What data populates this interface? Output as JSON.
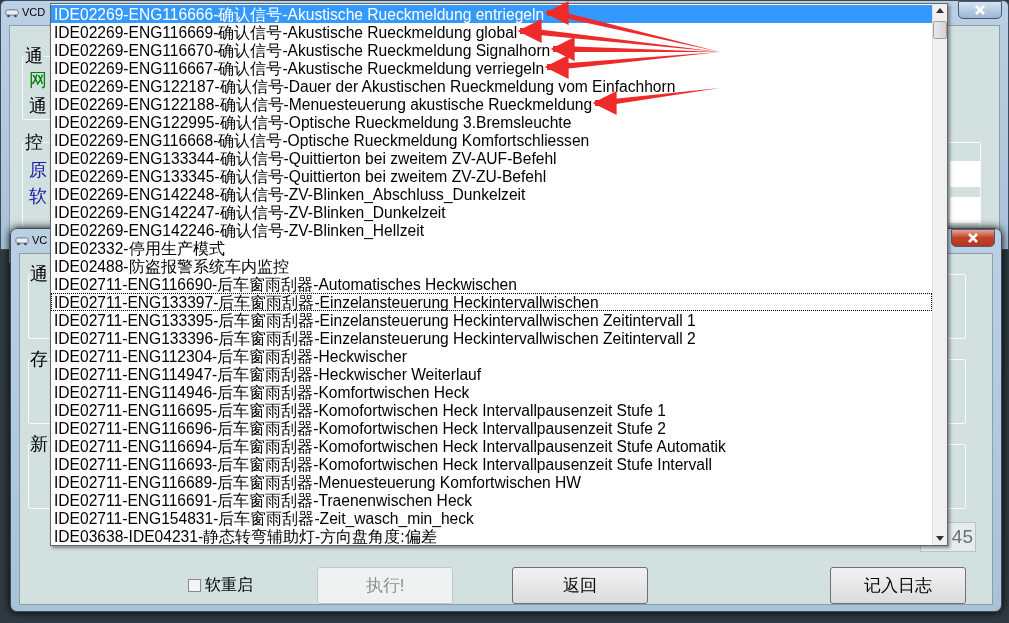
{
  "back_window": {
    "title": "VCD",
    "group_1": {
      "label": "通",
      "lines": [
        {
          "text": "网",
          "color": "#008000"
        },
        {
          "text": "通",
          "color": "#000000"
        }
      ]
    },
    "group_2": {
      "label": "控",
      "lines": [
        {
          "text": "原",
          "color": "#1a1aa0"
        },
        {
          "text": "软",
          "color": "#1a1aa0"
        }
      ]
    }
  },
  "front_window": {
    "title": "VC",
    "groups": [
      {
        "label": "通"
      },
      {
        "label": "存"
      },
      {
        "label": "新"
      }
    ],
    "field_value": "45",
    "soft_restart": {
      "label": "软重启",
      "checked": false
    },
    "buttons": [
      {
        "label": "执行!",
        "disabled": true
      },
      {
        "label": "返回",
        "disabled": false
      },
      {
        "label": "记入日志",
        "disabled": false
      }
    ]
  },
  "dropdown": {
    "items": [
      {
        "text": "IDE02269-ENG116666-确认信号-Akustische Rueckmeldung entriegeln",
        "selected": true,
        "focused": false,
        "marked": true
      },
      {
        "text": "IDE02269-ENG116669-确认信号-Akustische Rueckmeldung global",
        "selected": false,
        "focused": false,
        "marked": true
      },
      {
        "text": "IDE02269-ENG116670-确认信号-Akustische Rueckmeldung Signalhorn",
        "selected": false,
        "focused": false,
        "marked": true
      },
      {
        "text": "IDE02269-ENG116667-确认信号-Akustische Rueckmeldung verriegeln",
        "selected": false,
        "focused": false,
        "marked": true
      },
      {
        "text": "IDE02269-ENG122187-确认信号-Dauer der Akustischen Rueckmeldung vom Einfachhorn",
        "selected": false,
        "focused": false,
        "marked": false
      },
      {
        "text": "IDE02269-ENG122188-确认信号-Menuesteuerung akustische Rueckmeldung",
        "selected": false,
        "focused": false,
        "marked": true
      },
      {
        "text": "IDE02269-ENG122995-确认信号-Optische Rueckmeldung 3.Bremsleuchte",
        "selected": false,
        "focused": false,
        "marked": false
      },
      {
        "text": "IDE02269-ENG116668-确认信号-Optische Rueckmeldung Komfortschliessen",
        "selected": false,
        "focused": false,
        "marked": false
      },
      {
        "text": "IDE02269-ENG133344-确认信号-Quittierton bei zweitem ZV-AUF-Befehl",
        "selected": false,
        "focused": false,
        "marked": false
      },
      {
        "text": "IDE02269-ENG133345-确认信号-Quittierton bei zweitem ZV-ZU-Befehl",
        "selected": false,
        "focused": false,
        "marked": false
      },
      {
        "text": "IDE02269-ENG142248-确认信号-ZV-Blinken_Abschluss_Dunkelzeit",
        "selected": false,
        "focused": false,
        "marked": false
      },
      {
        "text": "IDE02269-ENG142247-确认信号-ZV-Blinken_Dunkelzeit",
        "selected": false,
        "focused": false,
        "marked": false
      },
      {
        "text": "IDE02269-ENG142246-确认信号-ZV-Blinken_Hellzeit",
        "selected": false,
        "focused": false,
        "marked": false
      },
      {
        "text": "IDE02332-停用生产模式",
        "selected": false,
        "focused": false,
        "marked": false
      },
      {
        "text": "IDE02488-防盗报警系统车内监控",
        "selected": false,
        "focused": false,
        "marked": false
      },
      {
        "text": "IDE02711-ENG116690-后车窗雨刮器-Automatisches Heckwischen",
        "selected": false,
        "focused": false,
        "marked": false
      },
      {
        "text": "IDE02711-ENG133397-后车窗雨刮器-Einzelansteuerung Heckintervallwischen",
        "selected": false,
        "focused": true,
        "marked": false
      },
      {
        "text": "IDE02711-ENG133395-后车窗雨刮器-Einzelansteuerung Heckintervallwischen Zeitintervall 1",
        "selected": false,
        "focused": false,
        "marked": false
      },
      {
        "text": "IDE02711-ENG133396-后车窗雨刮器-Einzelansteuerung Heckintervallwischen Zeitintervall 2",
        "selected": false,
        "focused": false,
        "marked": false
      },
      {
        "text": "IDE02711-ENG112304-后车窗雨刮器-Heckwischer",
        "selected": false,
        "focused": false,
        "marked": false
      },
      {
        "text": "IDE02711-ENG114947-后车窗雨刮器-Heckwischer Weiterlauf",
        "selected": false,
        "focused": false,
        "marked": false
      },
      {
        "text": "IDE02711-ENG114946-后车窗雨刮器-Komfortwischen Heck",
        "selected": false,
        "focused": false,
        "marked": false
      },
      {
        "text": "IDE02711-ENG116695-后车窗雨刮器-Komofortwischen Heck Intervallpausenzeit Stufe 1",
        "selected": false,
        "focused": false,
        "marked": false
      },
      {
        "text": "IDE02711-ENG116696-后车窗雨刮器-Komofortwischen Heck Intervallpausenzeit Stufe 2",
        "selected": false,
        "focused": false,
        "marked": false
      },
      {
        "text": "IDE02711-ENG116694-后车窗雨刮器-Komofortwischen Heck Intervallpausenzeit Stufe Automatik",
        "selected": false,
        "focused": false,
        "marked": false
      },
      {
        "text": "IDE02711-ENG116693-后车窗雨刮器-Komofortwischen Heck Intervallpausenzeit Stufe Intervall",
        "selected": false,
        "focused": false,
        "marked": false
      },
      {
        "text": "IDE02711-ENG116689-后车窗雨刮器-Menuesteuerung Komfortwischen HW",
        "selected": false,
        "focused": false,
        "marked": false
      },
      {
        "text": "IDE02711-ENG116691-后车窗雨刮器-Traenenwischen Heck",
        "selected": false,
        "focused": false,
        "marked": false
      },
      {
        "text": "IDE02711-ENG154831-后车窗雨刮器-Zeit_wasch_min_heck",
        "selected": false,
        "focused": false,
        "marked": false
      },
      {
        "text": "IDE03638-IDE04231-静态转弯辅助灯-方向盘角度:偏差",
        "selected": false,
        "focused": false,
        "marked": false
      }
    ]
  }
}
